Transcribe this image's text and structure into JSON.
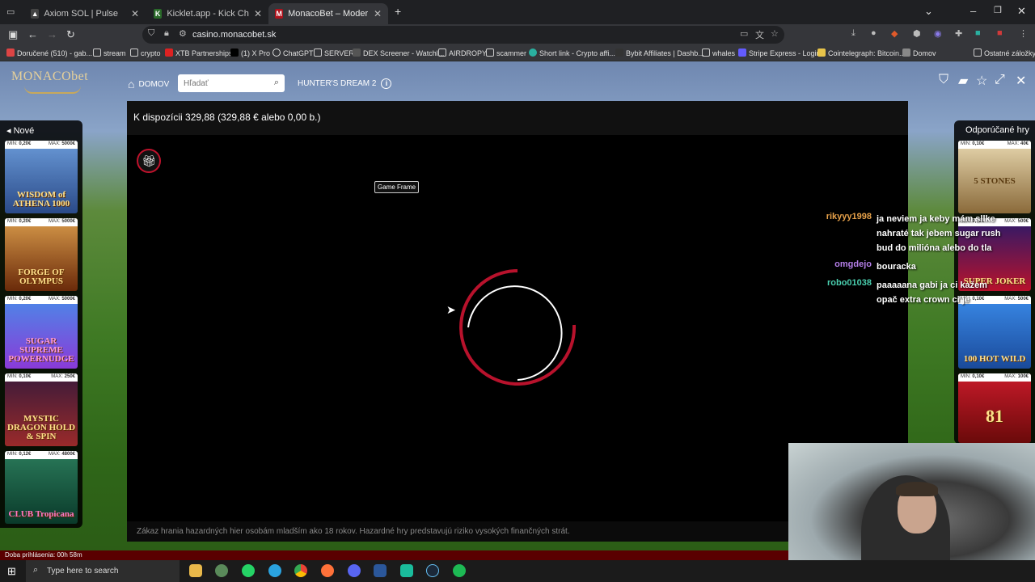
{
  "browser": {
    "tabs": [
      {
        "label": "Axiom SOL | Pulse",
        "active": false
      },
      {
        "label": "Kicklet.app - Kick Chatbot and",
        "active": false
      },
      {
        "label": "MonacoBet – Moderné Online",
        "active": true
      }
    ],
    "url": "casino.monacobet.sk",
    "bookmarks": [
      "Doručené (510) - gab...",
      "stream",
      "crypto",
      "XTB Partnerships",
      "(1) X Pro",
      "ChatGPT",
      "SERVER",
      "DEX Screener - Watchl...",
      "AIRDROPY",
      "scammer",
      "Short link - Crypto affi...",
      "Bybit Affiliates | Dashb...",
      "whales",
      "Stripe Express - Login",
      "Cointelegraph: Bitcoin...",
      "Domov",
      "Ostatné záložky"
    ]
  },
  "site": {
    "logo": "MONACObet",
    "home_label": "DOMOV",
    "search_placeholder": "Hľadať",
    "game_title": "HUNTER'S DREAM 2",
    "available_text": "K dispozícii 329,88 (329,88 € alebo 0,00 b.)",
    "game_frame_label": "Game Frame",
    "warning": "Zákaz hrania hazardných hier osobám mladším ako 18 rokov. Hazardné hry predstavujú riziko vysokých finančných strát.",
    "session_time": "Doba prihlásenia: 00h 58m"
  },
  "left_panel": {
    "title": "Nové",
    "games": [
      {
        "name": "WISDOM of ATHENA 1000",
        "min": "0,20€",
        "max": "5000€",
        "color": "#3c6ba8"
      },
      {
        "name": "FORGE OF OLYMPUS",
        "min": "0,20€",
        "max": "5000€",
        "color": "#8a4a1c"
      },
      {
        "name": "SUGAR SUPREME POWERNUDGE",
        "min": "0,20€",
        "max": "5000€",
        "color": "#6a3aa8"
      },
      {
        "name": "MYSTIC DRAGON HOLD & SPIN",
        "min": "0,10€",
        "max": "250€",
        "color": "#7a1a2a"
      },
      {
        "name": "CLUB Tropicana",
        "min": "0,12€",
        "max": "4800€",
        "color": "#1d6a4a"
      }
    ]
  },
  "right_panel": {
    "title": "Odporúčané hry",
    "games": [
      {
        "name": "5 STONES",
        "min": "0,10€",
        "max": "40€",
        "color": "#b89a62"
      },
      {
        "name": "SUPER JOKER",
        "min": "0,10€",
        "max": "500€",
        "color": "#3a2a8a"
      },
      {
        "name": "100 HOT WILD",
        "min": "0,10€",
        "max": "500€",
        "color": "#2a5ab8"
      },
      {
        "name": "81",
        "min": "0,10€",
        "max": "100€",
        "color": "#9a1a1a"
      }
    ]
  },
  "chat": [
    {
      "user": "rikyyy1998",
      "color": "#e8a24a",
      "msg": "ja neviem ja keby mám sllke nahraté tak jebem sugar rush bud do milióna alebo do tla"
    },
    {
      "user": "omgdejo",
      "color": "#b47ee8",
      "msg": "bouracka"
    },
    {
      "user": "robo01038",
      "color": "#4ad0b0",
      "msg": "paaaaana gabi ja ci kažem opač extra crown ci je"
    }
  ],
  "taskbar": {
    "search_placeholder": "Type here to search"
  }
}
